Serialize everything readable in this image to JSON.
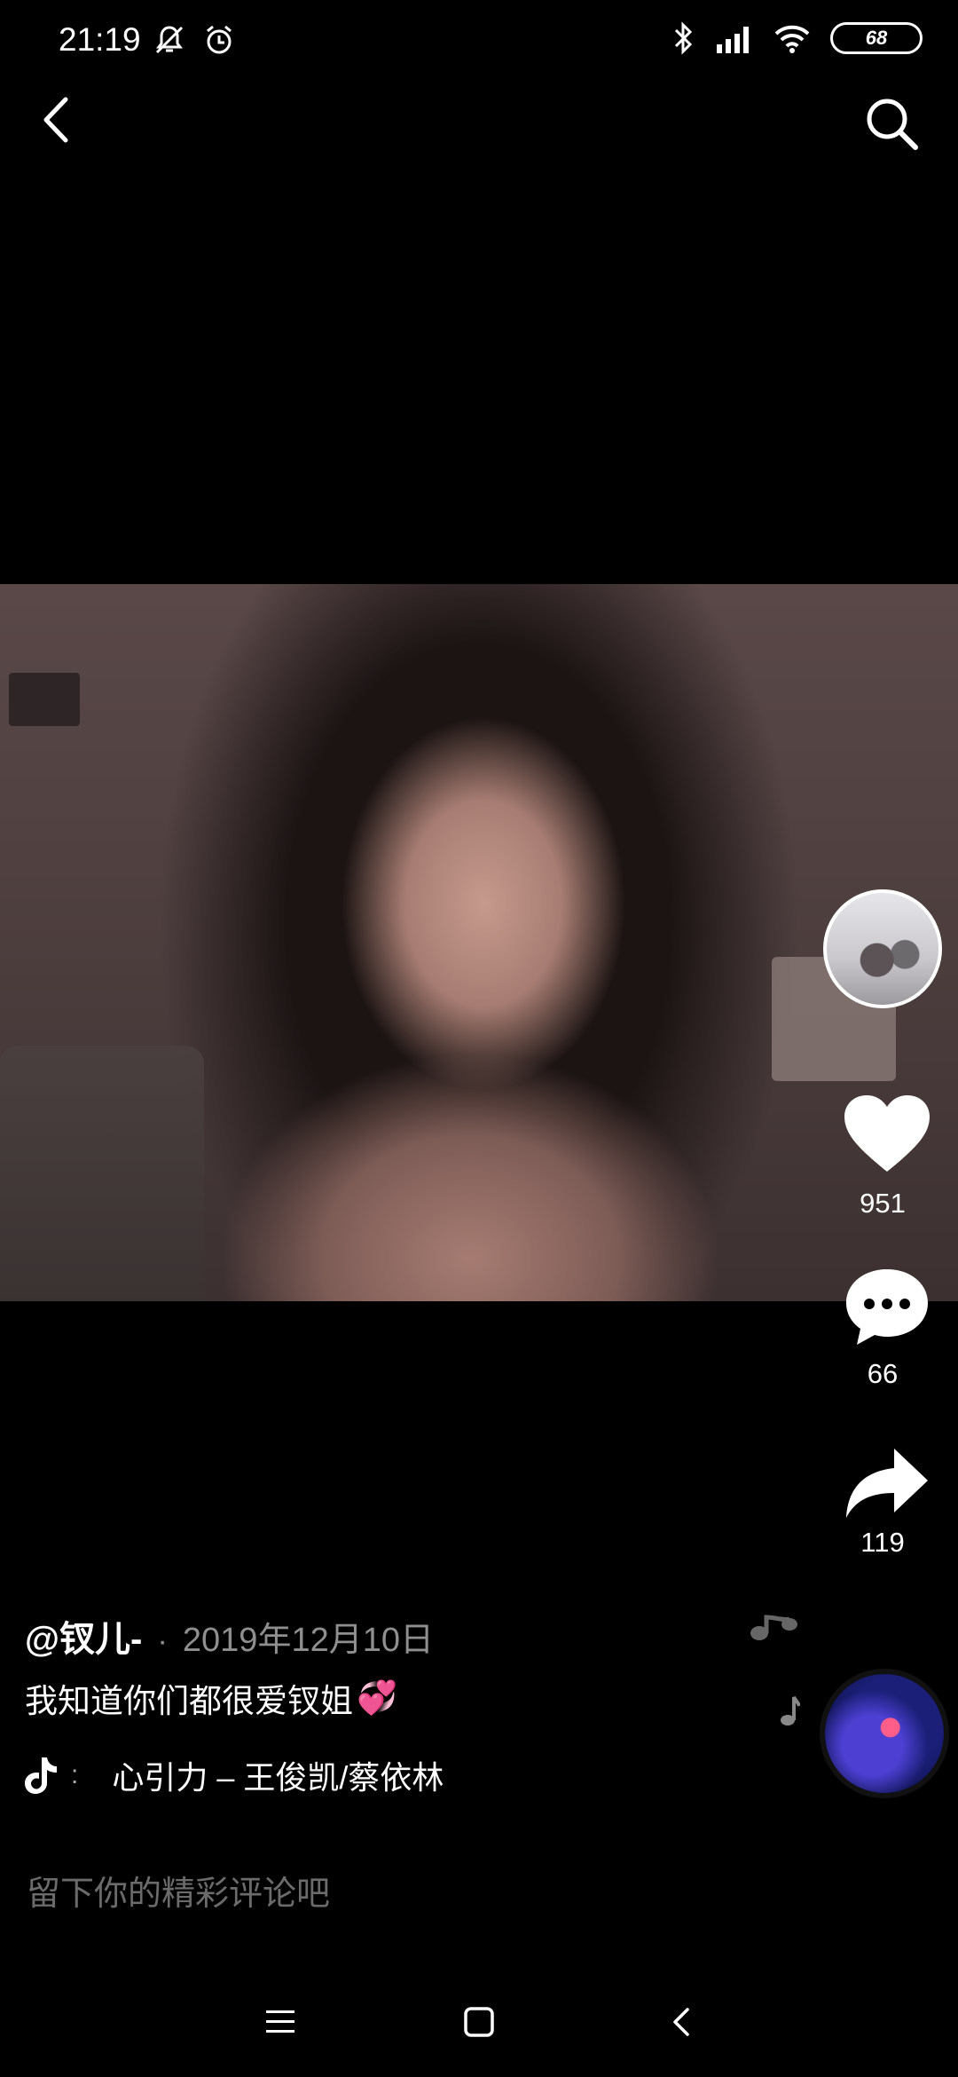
{
  "status_bar": {
    "time": "21:19",
    "battery": "68",
    "icons_left": [
      "mute-icon",
      "alarm-icon"
    ],
    "icons_right": [
      "bluetooth-icon",
      "signal-icon",
      "wifi-icon",
      "battery-icon"
    ]
  },
  "top_nav": {
    "back_icon": "chevron-left-icon",
    "search_icon": "search-icon"
  },
  "right_rail": {
    "like_count": "951",
    "comment_count": "66",
    "share_count": "119"
  },
  "post": {
    "author": "@钗儿-",
    "separator": "·",
    "date": "2019年12月10日",
    "caption": "我知道你们都很爱钗姐",
    "caption_emoji": "💞",
    "music_colon": ":",
    "music": "心引力 – 王俊凯/蔡依林"
  },
  "comment": {
    "placeholder": "留下你的精彩评论吧"
  },
  "colors": {
    "background": "#000000",
    "secondary_text": "#8f8f8f",
    "placeholder": "#6b6b6b"
  }
}
